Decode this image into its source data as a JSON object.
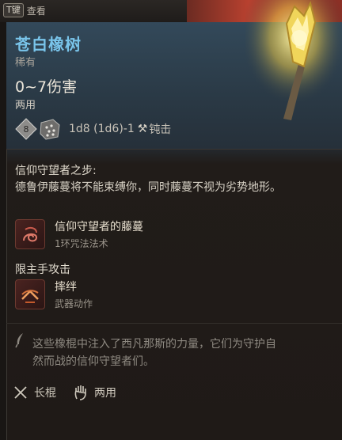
{
  "hud": {
    "key_label": "T键",
    "inspect_label": "查看"
  },
  "item": {
    "name": "苍白橡树",
    "rarity": "稀有",
    "damage": "0~7伤害",
    "handedness": "两用",
    "dice_text": "1d8 (1d6)-1",
    "damage_type": "钝击",
    "die_left_value": "8",
    "die_right_value": "6"
  },
  "passive": {
    "title": "信仰守望者之步:",
    "body": "德鲁伊藤蔓将不能束缚你，同时藤蔓不视为劣势地形。"
  },
  "spell": {
    "name": "信仰守望者的藤蔓",
    "subtitle": "1环咒法法术"
  },
  "mainhand": {
    "title": "限主手攻击"
  },
  "action": {
    "name": "摔绊",
    "subtitle": "武器动作"
  },
  "flavor_text": "这些橡棍中注入了西凡那斯的力量，它们为守护自然而战的信仰守望者们。",
  "footer": {
    "weapon_type": "长棍",
    "handedness": "两用"
  },
  "colors": {
    "name_color": "#79c4ea",
    "rarity_text": "#a9a49b",
    "body_text": "#d8d2c6",
    "flavor_text": "#8f8a82"
  },
  "icons": {
    "hammer": "hammer-icon",
    "spell": "vine-spell-icon",
    "action": "trip-action-icon",
    "quill": "quill-icon",
    "staff": "staff-icon",
    "hand": "hand-icon"
  }
}
